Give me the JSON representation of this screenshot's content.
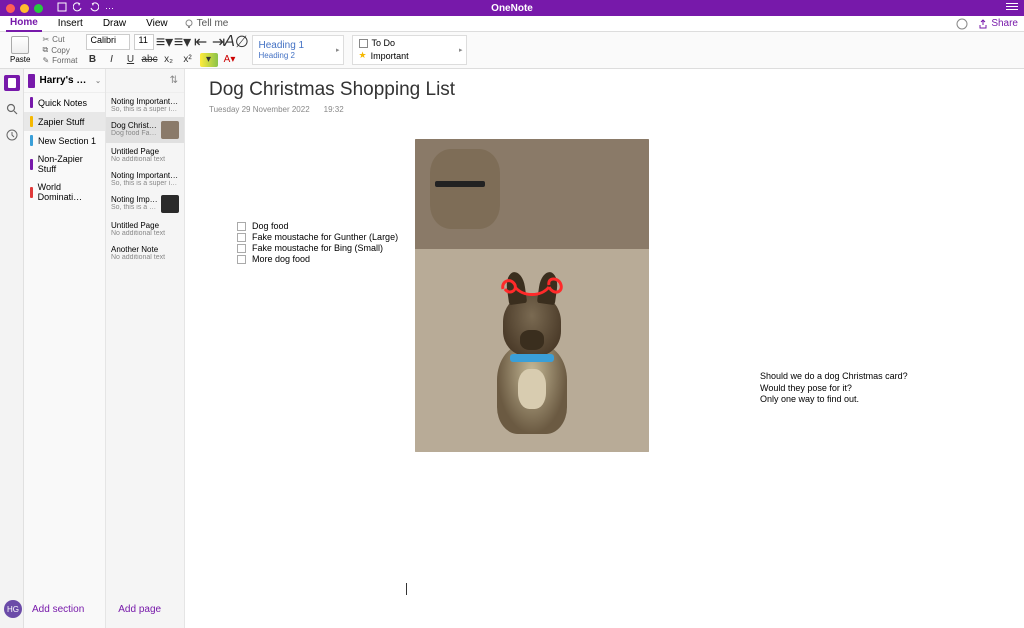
{
  "app": {
    "title": "OneNote"
  },
  "menu": {
    "items": [
      "Home",
      "Insert",
      "Draw",
      "View"
    ],
    "active": "Home",
    "tellme": "Tell me",
    "share": "Share"
  },
  "ribbon": {
    "paste": "Paste",
    "cut": "Cut",
    "copy": "Copy",
    "format": "Format",
    "font": "Calibri",
    "size": "11",
    "style1": "Heading 1",
    "style2": "Heading 2",
    "tag_todo": "To Do",
    "tag_important": "Important"
  },
  "notebook": {
    "name": "Harry's Notebook",
    "sections": [
      {
        "label": "Quick Notes",
        "color": "#7719AA"
      },
      {
        "label": "Zapier Stuff",
        "color": "#f5b800"
      },
      {
        "label": "New Section 1",
        "color": "#3a9fd8"
      },
      {
        "label": "Non-Zapier Stuff",
        "color": "#7719AA"
      },
      {
        "label": "World Dominati…",
        "color": "#e03a3a"
      }
    ],
    "selected_section": 1,
    "pages": [
      {
        "title": "Noting Important…",
        "sub": "So, this is a super im…",
        "thumb": false
      },
      {
        "title": "Dog Christ…",
        "sub": "Dog food  Fa…",
        "thumb": true,
        "thumb_dark": false
      },
      {
        "title": "Untitled Page",
        "sub": "No additional text",
        "thumb": false
      },
      {
        "title": "Noting Important…",
        "sub": "So, this is a super im…",
        "thumb": false
      },
      {
        "title": "Noting Imp…",
        "sub": "So, this is a s…",
        "thumb": true,
        "thumb_dark": true
      },
      {
        "title": "Untitled Page",
        "sub": "No additional text",
        "thumb": false
      },
      {
        "title": "Another Note",
        "sub": "No additional text",
        "thumb": false
      }
    ],
    "selected_page": 1
  },
  "note": {
    "title": "Dog Christmas Shopping List",
    "date": "Tuesday 29 November 2022",
    "time": "19:32",
    "checklist": [
      "Dog food",
      "Fake moustache for Gunther (Large)",
      "Fake moustache for Bing (Small)",
      "More dog food"
    ],
    "side_text": [
      "Should we do a dog Christmas card?",
      "Would they pose for it?",
      "Only one way to find out."
    ]
  },
  "footer": {
    "avatar": "HG",
    "add_section": "Add section",
    "add_page": "Add page"
  }
}
